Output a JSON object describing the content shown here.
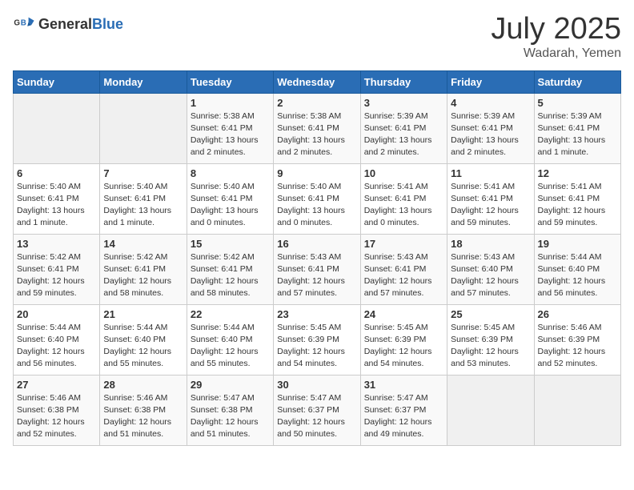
{
  "logo": {
    "general": "General",
    "blue": "Blue"
  },
  "header": {
    "month": "July 2025",
    "location": "Wadarah, Yemen"
  },
  "weekdays": [
    "Sunday",
    "Monday",
    "Tuesday",
    "Wednesday",
    "Thursday",
    "Friday",
    "Saturday"
  ],
  "weeks": [
    [
      {
        "day": "",
        "info": ""
      },
      {
        "day": "",
        "info": ""
      },
      {
        "day": "1",
        "info": "Sunrise: 5:38 AM\nSunset: 6:41 PM\nDaylight: 13 hours and 2 minutes."
      },
      {
        "day": "2",
        "info": "Sunrise: 5:38 AM\nSunset: 6:41 PM\nDaylight: 13 hours and 2 minutes."
      },
      {
        "day": "3",
        "info": "Sunrise: 5:39 AM\nSunset: 6:41 PM\nDaylight: 13 hours and 2 minutes."
      },
      {
        "day": "4",
        "info": "Sunrise: 5:39 AM\nSunset: 6:41 PM\nDaylight: 13 hours and 2 minutes."
      },
      {
        "day": "5",
        "info": "Sunrise: 5:39 AM\nSunset: 6:41 PM\nDaylight: 13 hours and 1 minute."
      }
    ],
    [
      {
        "day": "6",
        "info": "Sunrise: 5:40 AM\nSunset: 6:41 PM\nDaylight: 13 hours and 1 minute."
      },
      {
        "day": "7",
        "info": "Sunrise: 5:40 AM\nSunset: 6:41 PM\nDaylight: 13 hours and 1 minute."
      },
      {
        "day": "8",
        "info": "Sunrise: 5:40 AM\nSunset: 6:41 PM\nDaylight: 13 hours and 0 minutes."
      },
      {
        "day": "9",
        "info": "Sunrise: 5:40 AM\nSunset: 6:41 PM\nDaylight: 13 hours and 0 minutes."
      },
      {
        "day": "10",
        "info": "Sunrise: 5:41 AM\nSunset: 6:41 PM\nDaylight: 13 hours and 0 minutes."
      },
      {
        "day": "11",
        "info": "Sunrise: 5:41 AM\nSunset: 6:41 PM\nDaylight: 12 hours and 59 minutes."
      },
      {
        "day": "12",
        "info": "Sunrise: 5:41 AM\nSunset: 6:41 PM\nDaylight: 12 hours and 59 minutes."
      }
    ],
    [
      {
        "day": "13",
        "info": "Sunrise: 5:42 AM\nSunset: 6:41 PM\nDaylight: 12 hours and 59 minutes."
      },
      {
        "day": "14",
        "info": "Sunrise: 5:42 AM\nSunset: 6:41 PM\nDaylight: 12 hours and 58 minutes."
      },
      {
        "day": "15",
        "info": "Sunrise: 5:42 AM\nSunset: 6:41 PM\nDaylight: 12 hours and 58 minutes."
      },
      {
        "day": "16",
        "info": "Sunrise: 5:43 AM\nSunset: 6:41 PM\nDaylight: 12 hours and 57 minutes."
      },
      {
        "day": "17",
        "info": "Sunrise: 5:43 AM\nSunset: 6:41 PM\nDaylight: 12 hours and 57 minutes."
      },
      {
        "day": "18",
        "info": "Sunrise: 5:43 AM\nSunset: 6:40 PM\nDaylight: 12 hours and 57 minutes."
      },
      {
        "day": "19",
        "info": "Sunrise: 5:44 AM\nSunset: 6:40 PM\nDaylight: 12 hours and 56 minutes."
      }
    ],
    [
      {
        "day": "20",
        "info": "Sunrise: 5:44 AM\nSunset: 6:40 PM\nDaylight: 12 hours and 56 minutes."
      },
      {
        "day": "21",
        "info": "Sunrise: 5:44 AM\nSunset: 6:40 PM\nDaylight: 12 hours and 55 minutes."
      },
      {
        "day": "22",
        "info": "Sunrise: 5:44 AM\nSunset: 6:40 PM\nDaylight: 12 hours and 55 minutes."
      },
      {
        "day": "23",
        "info": "Sunrise: 5:45 AM\nSunset: 6:39 PM\nDaylight: 12 hours and 54 minutes."
      },
      {
        "day": "24",
        "info": "Sunrise: 5:45 AM\nSunset: 6:39 PM\nDaylight: 12 hours and 54 minutes."
      },
      {
        "day": "25",
        "info": "Sunrise: 5:45 AM\nSunset: 6:39 PM\nDaylight: 12 hours and 53 minutes."
      },
      {
        "day": "26",
        "info": "Sunrise: 5:46 AM\nSunset: 6:39 PM\nDaylight: 12 hours and 52 minutes."
      }
    ],
    [
      {
        "day": "27",
        "info": "Sunrise: 5:46 AM\nSunset: 6:38 PM\nDaylight: 12 hours and 52 minutes."
      },
      {
        "day": "28",
        "info": "Sunrise: 5:46 AM\nSunset: 6:38 PM\nDaylight: 12 hours and 51 minutes."
      },
      {
        "day": "29",
        "info": "Sunrise: 5:47 AM\nSunset: 6:38 PM\nDaylight: 12 hours and 51 minutes."
      },
      {
        "day": "30",
        "info": "Sunrise: 5:47 AM\nSunset: 6:37 PM\nDaylight: 12 hours and 50 minutes."
      },
      {
        "day": "31",
        "info": "Sunrise: 5:47 AM\nSunset: 6:37 PM\nDaylight: 12 hours and 49 minutes."
      },
      {
        "day": "",
        "info": ""
      },
      {
        "day": "",
        "info": ""
      }
    ]
  ]
}
